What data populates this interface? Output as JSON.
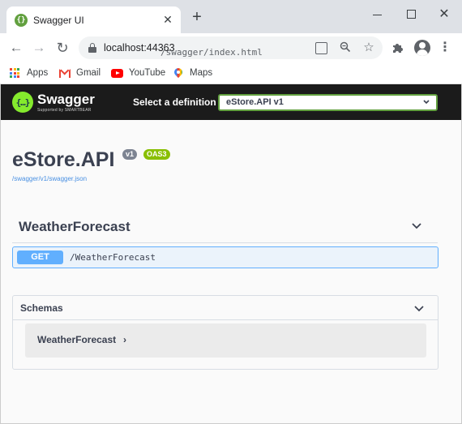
{
  "browser": {
    "tab_title": "Swagger UI",
    "tab_close": "✕",
    "new_tab": "+",
    "window_close": "✕",
    "address": {
      "host": "localhost:44363",
      "path": "/swagger/index.html"
    },
    "bookmarks": [
      "Apps",
      "Gmail",
      "YouTube",
      "Maps"
    ],
    "apps_colors": [
      "#ea4335",
      "#fbbc04",
      "#34a853",
      "#4285f4",
      "#ea4335",
      "#fbbc04",
      "#34a853",
      "#4285f4",
      "#ea4335"
    ]
  },
  "swagger": {
    "logo_text": "Swagger",
    "logo_sub": "Supported by SMARTBEAR",
    "definition_label": "Select a definition",
    "definition_value": "eStore.API v1",
    "api_title": "eStore.API",
    "version_badge": "v1",
    "oas_badge": "OAS3",
    "spec_url": "/swagger/v1/swagger.json",
    "tag_name": "WeatherForecast",
    "operation": {
      "method": "GET",
      "path": "/WeatherForecast"
    },
    "schemas": {
      "title": "Schemas",
      "items": [
        {
          "name": "WeatherForecast",
          "expand": "›"
        }
      ]
    },
    "colors": {
      "topbar": "#1b1b1b",
      "brand_green": "#85ea2d",
      "get_blue": "#61affe",
      "oas_green": "#89bf04"
    }
  }
}
